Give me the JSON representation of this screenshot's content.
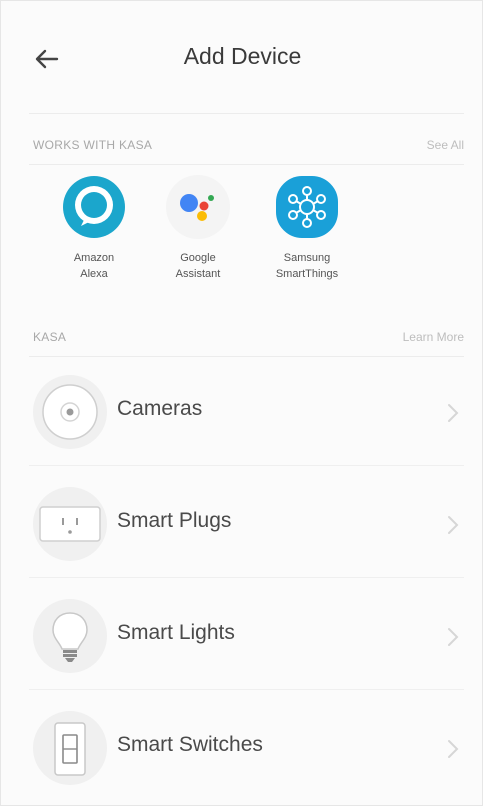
{
  "header": {
    "title": "Add Device",
    "back_icon": "arrow-left-icon"
  },
  "works_with": {
    "section_label": "WORKS WITH KASA",
    "see_all_label": "See All",
    "partners": [
      {
        "line1": "Amazon",
        "line2": "Alexa",
        "icon": "alexa-icon",
        "color": "#1ba6cc"
      },
      {
        "line1": "Google",
        "line2": "Assistant",
        "icon": "google-assistant-icon",
        "color": "#4285f4"
      },
      {
        "line1": "Samsung",
        "line2": "SmartThings",
        "icon": "smartthings-icon",
        "color": "#1aa0d8"
      }
    ]
  },
  "kasa": {
    "section_label": "KASA",
    "learn_more_label": "Learn More",
    "devices": [
      {
        "label": "Cameras",
        "icon": "camera-icon"
      },
      {
        "label": "Smart Plugs",
        "icon": "smart-plug-icon"
      },
      {
        "label": "Smart Lights",
        "icon": "light-bulb-icon"
      },
      {
        "label": "Smart Switches",
        "icon": "light-switch-icon"
      }
    ]
  }
}
